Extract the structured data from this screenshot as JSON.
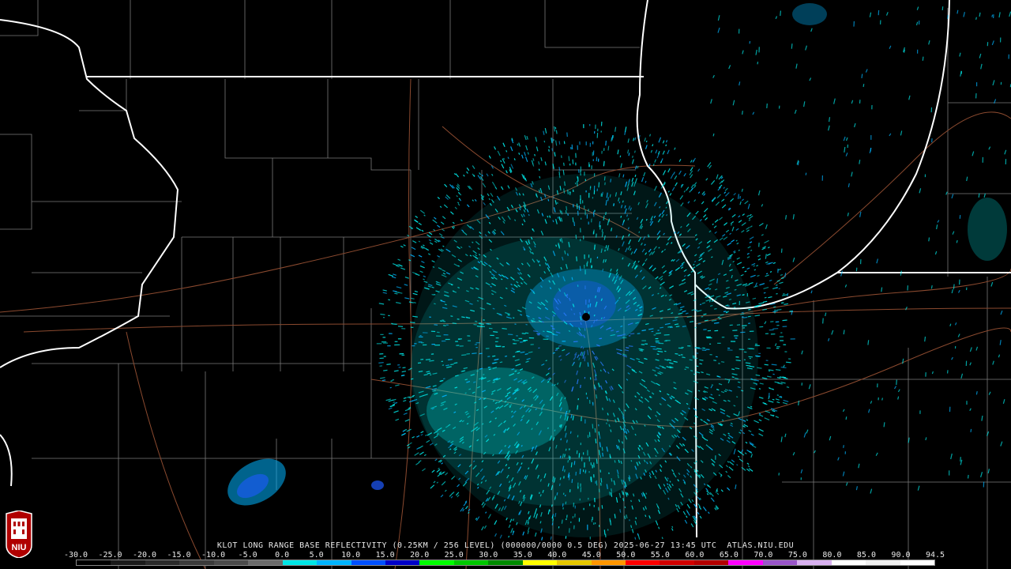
{
  "caption": "KLOT LONG RANGE BASE REFLECTIVITY (0.25KM / 256 LEVEL) (000000/0000 0.5 DEG) 2025-06-27 13:45 UTC  ATLAS.NIU.EDU",
  "radar": {
    "site": "KLOT",
    "product": "LONG RANGE BASE REFLECTIVITY",
    "timestamp": "2025-06-27 13:45 UTC"
  },
  "scale": {
    "labels": [
      "-30.0",
      "-25.0",
      "-20.0",
      "-15.0",
      "-10.0",
      "-5.0",
      "0.0",
      "5.0",
      "10.0",
      "15.0",
      "20.0",
      "25.0",
      "30.0",
      "35.0",
      "40.0",
      "45.0",
      "50.0",
      "55.0",
      "60.0",
      "65.0",
      "70.0",
      "75.0",
      "80.0",
      "85.0",
      "90.0",
      "94.5"
    ],
    "colors": [
      "#000000",
      "#1a1a1a",
      "#2a2a2a",
      "#3a3a3a",
      "#4a4a4a",
      "#6a6a6a",
      "#00e6e6",
      "#00b4ff",
      "#0050ff",
      "#0000c8",
      "#00ff00",
      "#00c800",
      "#008c00",
      "#ffff00",
      "#e6c800",
      "#ff9600",
      "#ff0000",
      "#d20000",
      "#b40000",
      "#ff00ff",
      "#9955c9",
      "#d8b0f0",
      "#ffffff",
      "#f0f0f0",
      "#ffffff"
    ]
  },
  "logo": {
    "text": "NIU"
  },
  "colors": {
    "state_border": "#ffffff",
    "county_border": "#808080",
    "roads": "#8b4a2f",
    "echo_light": "#00e6e6",
    "echo_mid": "#00b4ff",
    "echo_strong": "#1e5aff"
  }
}
